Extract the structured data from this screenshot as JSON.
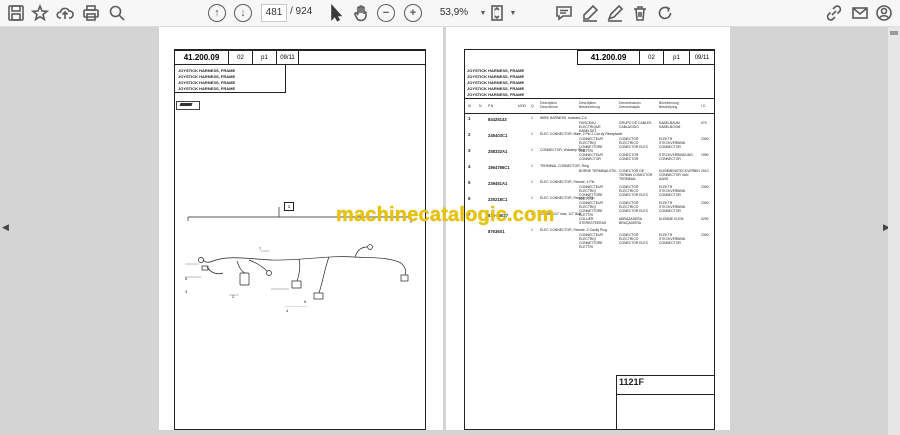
{
  "toolbar": {
    "current_page": "481",
    "page_separator": "/ 924",
    "zoom": "53,9%"
  },
  "left_page": {
    "doc_number": "41.200.09",
    "rev": "02",
    "page": "p1",
    "date": "09/11",
    "title_lines": [
      "JOYSTICK HARNESS, FRAME",
      "JOYSTICK HARNESS, FRAME",
      "JOYSTICK HARNESS, FRAME",
      "JOYSTICK HARNESS, FRAME"
    ],
    "callouts": [
      "1",
      "2",
      "3",
      "4",
      "5",
      "6",
      "7"
    ]
  },
  "right_page": {
    "doc_number": "41.200.09",
    "rev": "02",
    "page": "p1",
    "date": "09/11",
    "title_lines": [
      "JOYSTICK HARNESS, FRAME",
      "JOYSTICK HARNESS, FRAME",
      "JOYSTICK HARNESS, FRAME",
      "JOYSTICK HARNESS, FRAME",
      "JOYSTICK HARNESS, FRAME"
    ],
    "columns": [
      "Ill.",
      "N",
      "P.N.",
      "MOD",
      "Q",
      "Description Descrizione",
      "Description Beschreibung",
      "Denominación Denominação",
      "Bezeichnung Beschrijving",
      "I.C."
    ],
    "rows": [
      {
        "ill": "1",
        "pn": "84425143",
        "q": "1",
        "d1": "WIRE HARNESS, Includes 2-6",
        "d2": "FAISCEAU ELECTRIQUE KABELSET",
        "d3": "GRUPO DE CABLES CABLAGGIO",
        "d4": "KABELBAUM KABELBOOM",
        "ic": "070"
      },
      {
        "ill": "2",
        "pn": "245403C1",
        "q": "1",
        "d1": "ELEC CONNECTOR, Male, 2 Pin 2-Car by Receptacle",
        "d2": "CONNECTEUR ELECTRIQ CONNETTORE ELETTRI",
        "d3": "CONECTOR ELECTRICO CONECTOR ELEC",
        "d4": "ELEKTR STECKVERBIND CONNECTOR",
        "ic": "2300"
      },
      {
        "ill": "3",
        "pn": "258332A1",
        "q": "1",
        "d1": "CONNECTOR, Wdcamp Plug",
        "d2": "CONNECTEUR CONNECTOR",
        "d3": "CONECTOR CONECTOR",
        "d4": "STECKVERBINDUNG CONNECTOR",
        "ic": "1990"
      },
      {
        "ill": "4",
        "pn": "1964786C1",
        "q": "1",
        "d1": "TERMINAL CONNECTOR, Ring",
        "d2": "BORNE TERMINALSTIK",
        "d3": "CONECTOR DE TERMIN CONECTOR TERMINAL",
        "d4": "KLEMMENSTECKVERBIN CONNECTOR VAN AANS",
        "ic": "2010"
      },
      {
        "ill": "5",
        "pn": "239451A1",
        "q": "1",
        "d1": "ELEC CONNECTOR, Female, 4 Pin",
        "d2": "CONNECTEUR ELECTRIQ CONNETTORE ELETTRI",
        "d3": "CONECTOR ELECTRICO CONECTOR ELEC",
        "d4": "ELEKTR STECKVERBIND CONNECTOR",
        "ic": "2300"
      },
      {
        "ill": "6",
        "pn": "225218C1",
        "q": "1",
        "d1": "ELEC CONNECTOR, Female, 2 Pin",
        "d2": "CONNECTEUR ELECTRIQ CONNETTORE ELETTRI",
        "d3": "CONECTOR ELECTRICO CONECTOR ELEC",
        "d4": "ELEKTR STECKVERBIND CONNECTOR",
        "ic": "2300"
      },
      {
        "ill": "7",
        "pn": "515-25027",
        "q": "1",
        "d1": "CLAMP, 1/2\" max, 1/2\" Bolt",
        "d2": "COLLIER STERKSTEERAS",
        "d3": "ABRAZADERA BRAÇADEIRA",
        "d4": "KLEMME KLEM",
        "ic": "0290"
      },
      {
        "ill": "",
        "pn": "87636X1",
        "q": "1",
        "d1": "ELEC CONNECTOR, Female, 2-Cavity Plug",
        "d2": "CONNECTEUR ELECTRIQ CONNETTORE ELETTRI",
        "d3": "CONECTOR ELECTRICO CONECTOR ELEC",
        "d4": "ELEKTR STECKVERBIND CONNECTOR",
        "ic": "2300"
      }
    ],
    "footer_code": "1121F"
  },
  "watermark": "machinecatalogic.com"
}
